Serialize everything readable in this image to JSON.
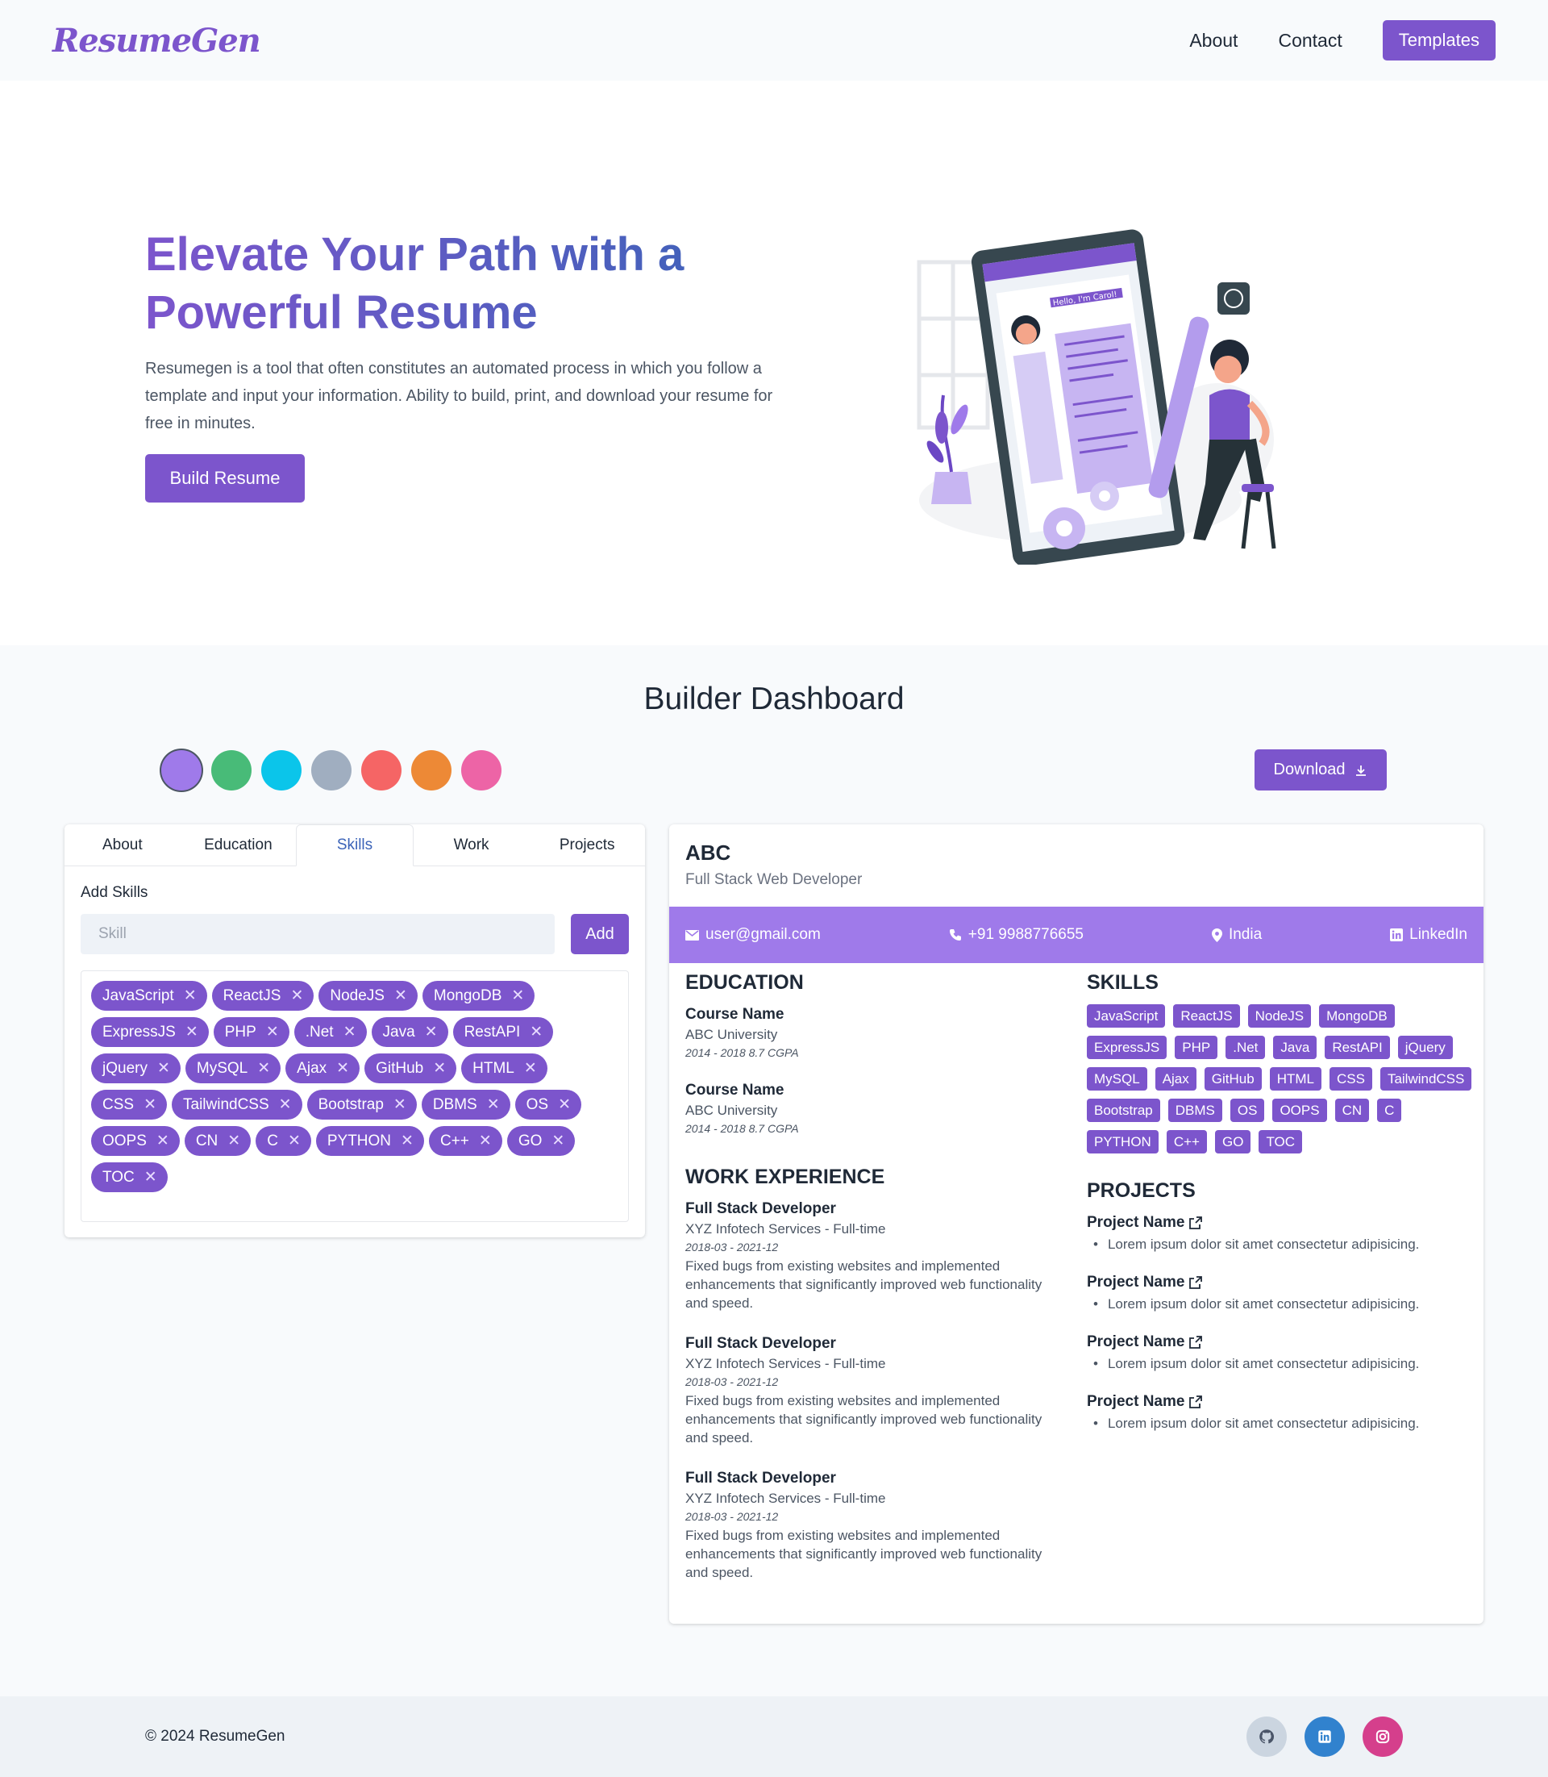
{
  "nav": {
    "logo": "ResumeGen",
    "about": "About",
    "contact": "Contact",
    "templates": "Templates"
  },
  "hero": {
    "title": "Elevate Your Path with a Powerful Resume",
    "description": "Resumegen is a tool that often constitutes an automated process in which you follow a template and input your information. Ability to build, print, and download your resume for free in minutes.",
    "button": "Build Resume",
    "illustration_text": "Hello, I'm Carol!"
  },
  "dashboard": {
    "title": "Builder Dashboard",
    "download": "Download",
    "theme_colors": [
      "#9f7aea",
      "#48bb78",
      "#0bc5ea",
      "#a0aec0",
      "#f56565",
      "#ed8936",
      "#ed64a6"
    ],
    "selected_color": "#9f7aea"
  },
  "editor": {
    "tabs": [
      "About",
      "Education",
      "Skills",
      "Work",
      "Projects"
    ],
    "active_tab": "Skills",
    "add_label": "Add Skills",
    "input_placeholder": "Skill",
    "add_button": "Add",
    "skills": [
      "JavaScript",
      "ReactJS",
      "NodeJS",
      "MongoDB",
      "ExpressJS",
      "PHP",
      ".Net",
      "Java",
      "RestAPI",
      "jQuery",
      "MySQL",
      "Ajax",
      "GitHub",
      "HTML",
      "CSS",
      "TailwindCSS",
      "Bootstrap",
      "DBMS",
      "OS",
      "OOPS",
      "CN",
      "C",
      "PYTHON",
      "C++",
      "GO",
      "TOC"
    ]
  },
  "preview": {
    "name": "ABC",
    "role": "Full Stack Web Developer",
    "email": "user@gmail.com",
    "phone": "+91 9988776655",
    "location": "India",
    "linkedin": "LinkedIn",
    "education_title": "EDUCATION",
    "education": [
      {
        "course": "Course Name",
        "school": "ABC University",
        "dates": "2014 - 2018",
        "grade": "8.7 CGPA"
      },
      {
        "course": "Course Name",
        "school": "ABC University",
        "dates": "2014 - 2018",
        "grade": "8.7 CGPA"
      }
    ],
    "skills_title": "SKILLS",
    "work_title": "WORK EXPERIENCE",
    "work": [
      {
        "title": "Full Stack Developer",
        "company": "XYZ Infotech Services - Full-time",
        "dates": "2018-03 - 2021-12",
        "desc": "Fixed bugs from existing websites and implemented enhancements that significantly improved web functionality and speed."
      },
      {
        "title": "Full Stack Developer",
        "company": "XYZ Infotech Services - Full-time",
        "dates": "2018-03 - 2021-12",
        "desc": "Fixed bugs from existing websites and implemented enhancements that significantly improved web functionality and speed."
      },
      {
        "title": "Full Stack Developer",
        "company": "XYZ Infotech Services - Full-time",
        "dates": "2018-03 - 2021-12",
        "desc": "Fixed bugs from existing websites and implemented enhancements that significantly improved web functionality and speed."
      }
    ],
    "projects_title": "PROJECTS",
    "projects": [
      {
        "name": "Project Name",
        "desc": "Lorem ipsum dolor sit amet consectetur adipisicing."
      },
      {
        "name": "Project Name",
        "desc": "Lorem ipsum dolor sit amet consectetur adipisicing."
      },
      {
        "name": "Project Name",
        "desc": "Lorem ipsum dolor sit amet consectetur adipisicing."
      },
      {
        "name": "Project Name",
        "desc": "Lorem ipsum dolor sit amet consectetur adipisicing."
      }
    ]
  },
  "footer": {
    "copyright": "© 2024 ResumeGen",
    "socials": [
      {
        "icon": "github-icon",
        "color": "#cbd5e0"
      },
      {
        "icon": "linkedin-icon",
        "color": "#3182ce"
      },
      {
        "icon": "instagram-icon",
        "color": "#d53f8c"
      }
    ]
  }
}
